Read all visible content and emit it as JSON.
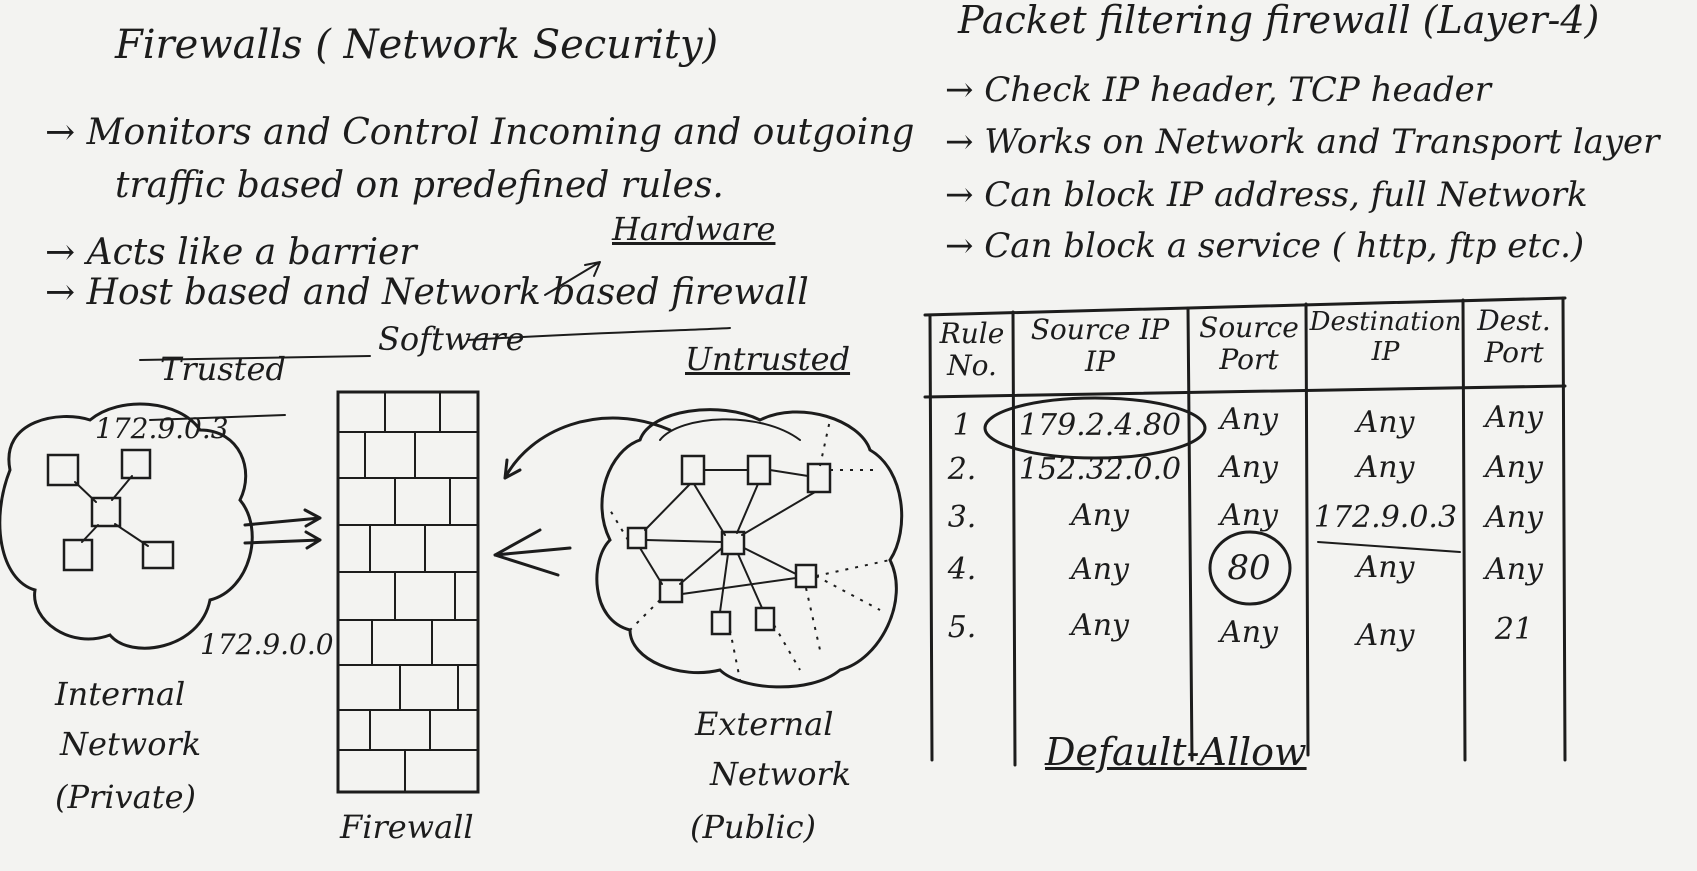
{
  "left": {
    "title": "Firewalls ( Network Security)",
    "bullets": [
      "→  Monitors and Control Incoming and outgoing",
      "traffic based on predefined rules.",
      "→  Acts like a barrier",
      "→  Host based and Network based firewall"
    ],
    "hardware": "Hardware",
    "software": "Software",
    "trusted": "Trusted",
    "untrusted": "Untrusted",
    "ip_host": "172.9.0.3",
    "ip_net": "172.9.0.0",
    "internal": [
      "Internal",
      "Network",
      "(Private)"
    ],
    "firewall": "Firewall",
    "external": [
      "External",
      "Network",
      "(Public)"
    ]
  },
  "right": {
    "title": "Packet filtering firewall (Layer-4)",
    "bullets": [
      "→  Check IP header, TCP header",
      "→  Works on Network and Transport layer",
      "→  Can block IP address, full Network",
      "→  Can block a service ( http, ftp etc.)"
    ],
    "table": {
      "headers": [
        [
          "Rule",
          "No."
        ],
        [
          "Source IP",
          "IP"
        ],
        [
          "Source",
          "Port"
        ],
        [
          "Destination",
          "IP"
        ],
        [
          "Dest.",
          "Port"
        ]
      ],
      "rows": [
        [
          "1",
          "179.2.4.80",
          "Any",
          "Any",
          "Any"
        ],
        [
          "2.",
          "152.32.0.0",
          "Any",
          "Any",
          "Any"
        ],
        [
          "3.",
          "Any",
          "Any",
          "172.9.0.3",
          "Any"
        ],
        [
          "4.",
          "Any",
          "80",
          "Any",
          "Any"
        ],
        [
          "5.",
          "Any",
          "Any",
          "Any",
          "21"
        ]
      ]
    },
    "default": "Default-Allow"
  }
}
